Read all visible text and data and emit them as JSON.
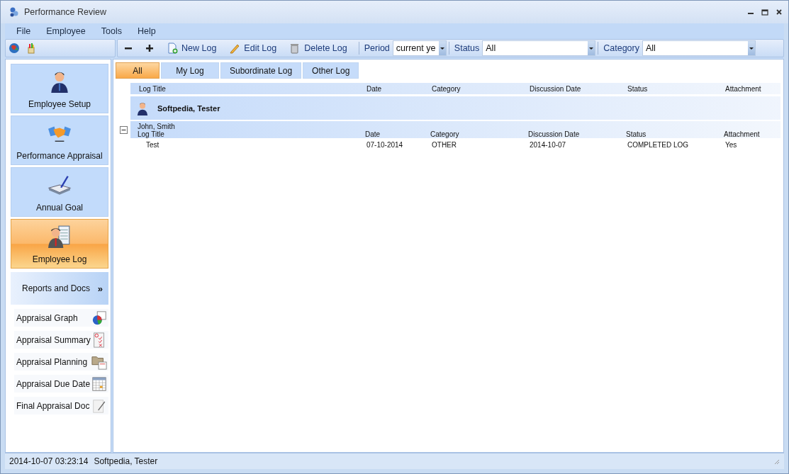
{
  "window": {
    "title": "Performance Review"
  },
  "menu": [
    "File",
    "Employee",
    "Tools",
    "Help"
  ],
  "toolbar": {
    "buttons": [
      {
        "kind": "collapse"
      },
      {
        "kind": "expand"
      },
      {
        "kind": "new",
        "label": "New Log"
      },
      {
        "kind": "edit",
        "label": "Edit Log"
      },
      {
        "kind": "delete",
        "label": "Delete Log"
      }
    ],
    "filters": [
      {
        "label": "Period",
        "value": "current ye"
      },
      {
        "label": "Status",
        "value": "All"
      },
      {
        "label": "Category",
        "value": "All"
      }
    ]
  },
  "tabs": [
    {
      "label": "All",
      "selected": true
    },
    {
      "label": "My Log",
      "selected": false
    },
    {
      "label": "Subordinate Log",
      "selected": false
    },
    {
      "label": "Other Log",
      "selected": false
    }
  ],
  "nav": [
    {
      "label": "Employee Setup",
      "selected": false
    },
    {
      "label": "Performance Appraisal",
      "selected": false
    },
    {
      "label": "Annual Goal",
      "selected": false
    },
    {
      "label": "Employee Log",
      "selected": true
    }
  ],
  "reports": {
    "title": "Reports and Docs",
    "toggle": "»",
    "items": [
      {
        "label": "Appraisal Graph"
      },
      {
        "label": "Appraisal Summary"
      },
      {
        "label": "Appraisal Planning"
      },
      {
        "label": "Appraisal Due Date"
      },
      {
        "label": "Final Appraisal Doc"
      }
    ]
  },
  "log": {
    "columns": [
      "Log Title",
      "Date",
      "Category",
      "Discussion Date",
      "Status",
      "Attachment"
    ],
    "owner": "Softpedia, Tester",
    "groups": [
      {
        "name": "John, Smith",
        "expanded": true,
        "columns": [
          "Log Title",
          "Date",
          "Category",
          "Discussion Date",
          "Status",
          "Attachment"
        ],
        "rows": [
          [
            "Test",
            "07-10-2014",
            "OTHER",
            "2014-10-07",
            "COMPLETED LOG",
            "Yes"
          ]
        ]
      }
    ]
  },
  "status_bar": [
    "2014-10-07 03:23:14",
    "Softpedia, Tester"
  ]
}
